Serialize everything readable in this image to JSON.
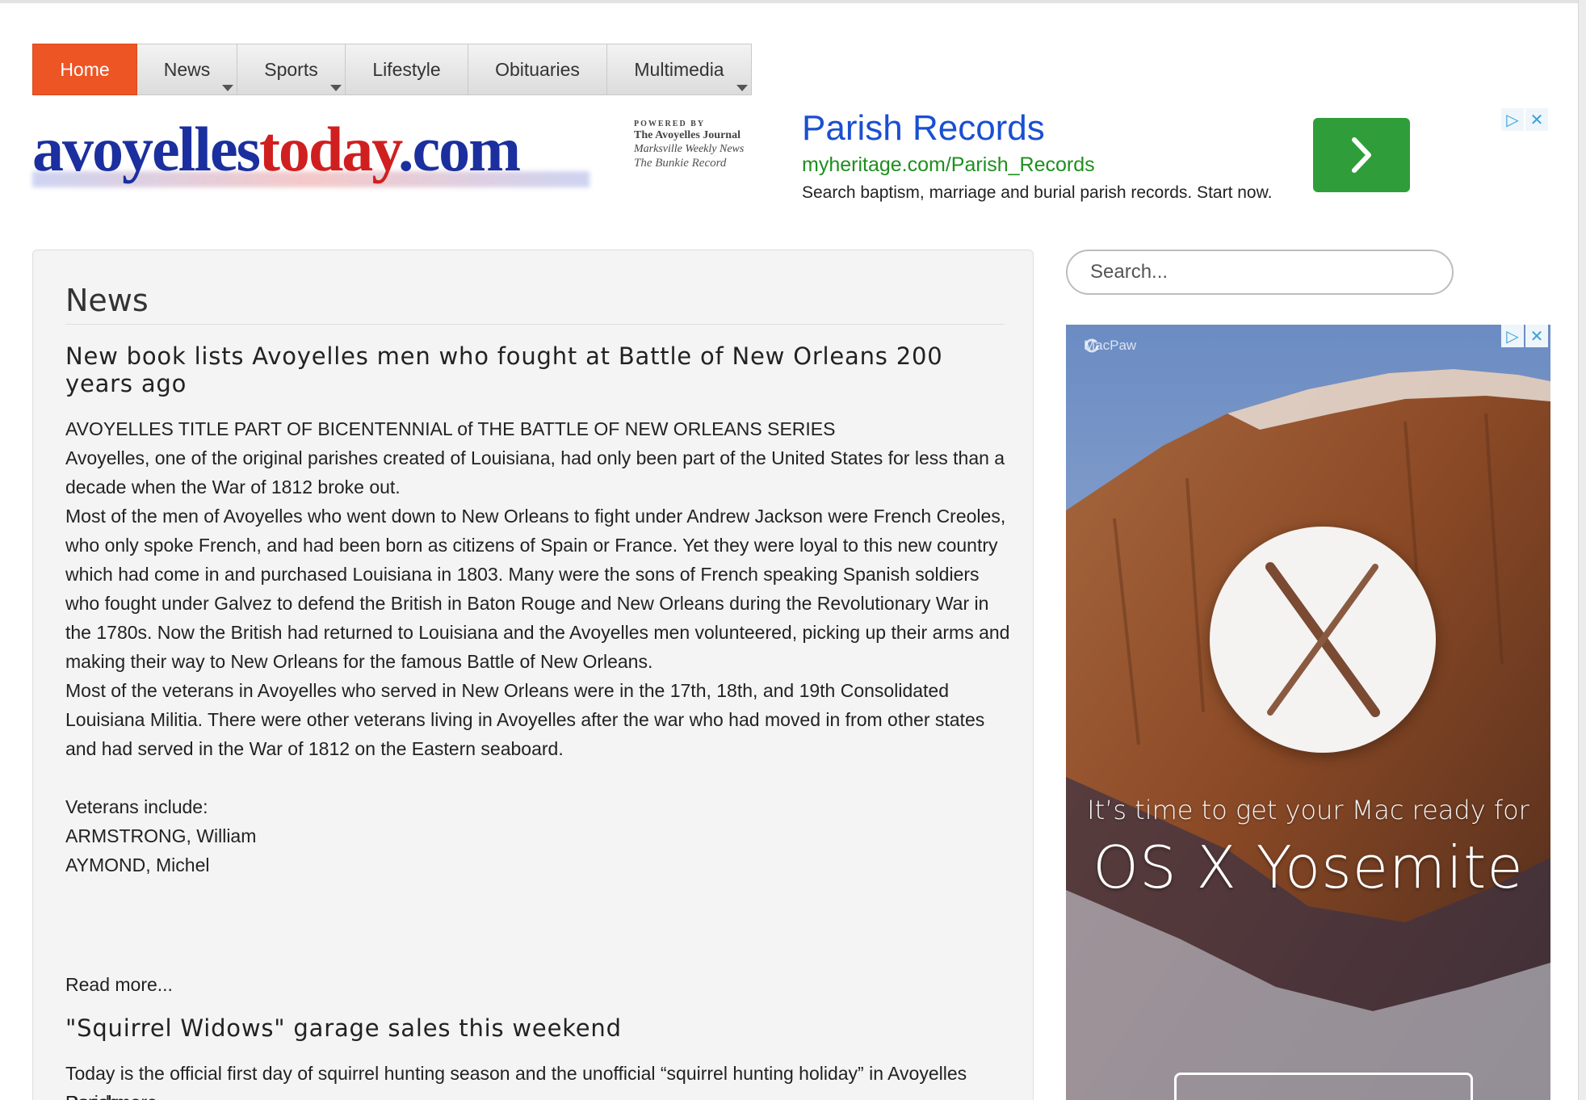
{
  "nav": {
    "items": [
      {
        "label": "Home",
        "active": true,
        "dropdown": false
      },
      {
        "label": "News",
        "active": false,
        "dropdown": true
      },
      {
        "label": "Sports",
        "active": false,
        "dropdown": true
      },
      {
        "label": "Lifestyle",
        "active": false,
        "dropdown": false
      },
      {
        "label": "Obituaries",
        "active": false,
        "dropdown": false
      },
      {
        "label": "Multimedia",
        "active": false,
        "dropdown": true
      }
    ]
  },
  "logo": {
    "part1": "avoyelles",
    "part2": "today",
    "part3": ".com",
    "powered_by": "POWERED BY",
    "pub1": "The Avoyelles Journal",
    "pub2": "Marksville Weekly News",
    "pub3": "The Bunkie Record"
  },
  "top_ad": {
    "title": "Parish Records",
    "url": "myheritage.com/Parish_Records",
    "description": "Search baptism, marriage and burial parish records. Start now.",
    "button_icon": "chevron-right-icon",
    "adchoices_icon": "adchoices-icon",
    "close_icon": "close-icon"
  },
  "main": {
    "section_title": "News",
    "articles": [
      {
        "title": "New book lists Avoyelles men who fought at Battle of New Orleans 200 years ago",
        "paragraphs": [
          "AVOYELLES TITLE PART OF BICENTENNIAL of THE BATTLE OF NEW ORLEANS SERIES",
          "Avoyelles, one of the original parishes created of Louisiana, had only been part of the United States for less than a decade when the War of 1812 broke out.",
          "Most of the men of Avoyelles who went down to New Orleans to fight under Andrew Jackson were French Creoles, who only spoke French, and had been born as citizens of Spain or France. Yet they were loyal to this new country which had come in and purchased Louisiana in 1803. Many were the sons of French speaking Spanish soldiers who fought under Galvez to defend the British in Baton Rouge and New Orleans during the Revolutionary War in the 1780s. Now the British had returned to Louisiana and the Avoyelles men volunteered, picking up their arms and making their way to New Orleans for the famous Battle of New Orleans.",
          "Most of the veterans in Avoyelles who served in New Orleans were in the 17th, 18th, and 19th Consolidated Louisiana Militia. There were other veterans living in Avoyelles after the war who had moved in from other states and had served in the War of 1812 on the Eastern seaboard."
        ],
        "list_intro": "Veterans include:",
        "list": [
          "ARMSTRONG, William",
          "AYMOND, Michel"
        ],
        "read_more": "Read more..."
      },
      {
        "title": "\"Squirrel Widows\" garage sales this weekend",
        "paragraphs": [
          "Today is the official first day of squirrel hunting season and the unofficial “squirrel hunting holiday” in Avoyelles Parish."
        ],
        "read_more": "Read more..."
      }
    ]
  },
  "sidebar": {
    "search_placeholder": "Search...",
    "ad": {
      "brand": "MacPaw",
      "line1": "It’s time to get your Mac ready for",
      "line2": "OS X Yosemite",
      "image": "yosemite-half-dome-with-osx-logo"
    }
  },
  "colors": {
    "nav_active": "#ee5524",
    "logo_blue": "#1b2f9e",
    "logo_red": "#d01f1f",
    "ad_title": "#1a4fd1",
    "ad_url": "#1d8f1d",
    "ad_button": "#2f9e3a"
  }
}
